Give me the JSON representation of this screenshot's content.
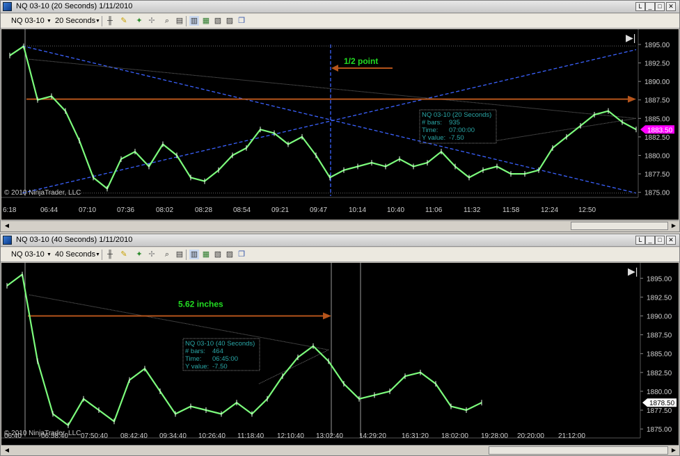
{
  "windows": [
    {
      "title": "NQ 03-10 (20 Seconds)  1/11/2010",
      "instrument": "NQ 03-10",
      "period": "20 Seconds",
      "window_buttons": [
        "L",
        "_",
        "□",
        "✕"
      ],
      "copyright": "© 2010 NinjaTrader, LLC",
      "chart_data": {
        "type": "line",
        "title": "",
        "ylim": [
          1874.5,
          1896.5
        ],
        "y_ticks": [
          "1895.00",
          "1892.50",
          "1890.00",
          "1887.50",
          "1885.00",
          "1882.50",
          "1880.00",
          "1877.50",
          "1875.00"
        ],
        "x_ticks": [
          "6:18",
          "06:44",
          "07:10",
          "07:36",
          "08:02",
          "08:28",
          "08:54",
          "09:21",
          "09:47",
          "10:14",
          "10:40",
          "11:06",
          "11:32",
          "11:58",
          "12:24",
          "12:50"
        ],
        "series": [
          {
            "values": [
              1893.5,
              1894.75,
              1887.5,
              1888.0,
              1886.0,
              1882.0,
              1877.0,
              1875.5,
              1879.5,
              1880.5,
              1878.5,
              1881.5,
              1880.0,
              1877.0,
              1876.5,
              1878.0,
              1880.0,
              1881.0,
              1883.5,
              1883.0,
              1881.5,
              1882.5,
              1880.0,
              1877.0,
              1878.0,
              1878.5,
              1879.0,
              1878.5,
              1879.5,
              1878.5,
              1879.0,
              1880.5,
              1878.5,
              1877.0,
              1878.0,
              1878.5,
              1877.5,
              1877.5,
              1878.0,
              1881.0,
              1882.5,
              1884.0,
              1885.5,
              1886.0,
              1884.5,
              1883.5
            ]
          }
        ],
        "current_price": "1883.50",
        "annotation_text": "1/2 point",
        "info_box": {
          "title": "NQ 03-10 (20 Seconds)",
          "bars_label": "# bars:",
          "bars_value": "935",
          "time_label": "Time:",
          "time_value": "07:00:00",
          "y_label": "Y value:",
          "y_value": "-7.50"
        }
      }
    },
    {
      "title": "NQ 03-10 (40 Seconds)  1/11/2010",
      "instrument": "NQ 03-10",
      "period": "40 Seconds",
      "window_buttons": [
        "L",
        "_",
        "□",
        "✕"
      ],
      "copyright": "© 2010 NinjaTrader, LLC",
      "chart_data": {
        "type": "line",
        "title": "",
        "ylim": [
          1874.0,
          1896.5
        ],
        "y_ticks": [
          "1895.00",
          "1892.50",
          "1890.00",
          "1887.50",
          "1885.00",
          "1882.50",
          "1880.00",
          "1877.50",
          "1875.00"
        ],
        "x_ticks": [
          "06:40",
          "06:58:40",
          "07:50:40",
          "08:42:40",
          "09:34:40",
          "10:26:40",
          "11:18:40",
          "12:10:40",
          "13:02:40",
          "14:29:20",
          "16:31:20",
          "18:02:00",
          "19:28:00",
          "20:20:00",
          "21:12:00"
        ],
        "series": [
          {
            "values": [
              1894.0,
              1895.5,
              1884.0,
              1877.0,
              1875.5,
              1879.0,
              1877.5,
              1876.0,
              1881.5,
              1883.0,
              1880.0,
              1877.0,
              1878.0,
              1877.5,
              1877.0,
              1878.5,
              1877.0,
              1879.0,
              1882.0,
              1884.5,
              1886.0,
              1884.0,
              1881.0,
              1879.0,
              1879.5,
              1880.0,
              1882.0,
              1882.5,
              1881.0,
              1878.0,
              1877.5,
              1878.5
            ]
          }
        ],
        "current_price": "1878.50",
        "annotation_text": "5.62 inches",
        "info_box": {
          "title": "NQ 03-10 (40 Seconds)",
          "bars_label": "# bars:",
          "bars_value": "464",
          "time_label": "Time:",
          "time_value": "06:45:00",
          "y_label": "Y value:",
          "y_value": "-7.50"
        }
      }
    }
  ],
  "colors": {
    "price_line": "#7CFC7C",
    "fib_lines": "#3b62ff",
    "arrow": "#b5541b",
    "annotation_text": "#22dd22",
    "info_text": "#2aa7a7",
    "price_marker_top": "#ff00ff",
    "price_marker_bottom": "#ffffff"
  },
  "icons": [
    "bar-type-icon",
    "pencil-icon",
    "draw-tools-icon",
    "crosshair-icon",
    "zoom-icon",
    "properties-icon",
    "data-box-icon",
    "indicators-icon",
    "strategies-icon",
    "print-icon",
    "copy-icon"
  ]
}
